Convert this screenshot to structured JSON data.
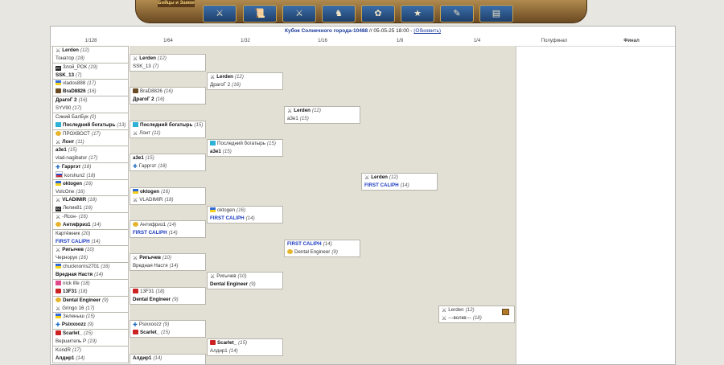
{
  "nav": {
    "logo_text": "Бойцы и Замки",
    "icons": [
      {
        "name": "battle-icon",
        "glyph": "⚔"
      },
      {
        "name": "scroll-icon",
        "glyph": "📜"
      },
      {
        "name": "swords-icon",
        "glyph": "⚔"
      },
      {
        "name": "knight-icon",
        "glyph": "♞"
      },
      {
        "name": "cake-icon",
        "glyph": "✿"
      },
      {
        "name": "stars-icon",
        "glyph": "★"
      },
      {
        "name": "book-icon",
        "glyph": "✎"
      },
      {
        "name": "chat-icon",
        "glyph": "▤"
      }
    ]
  },
  "header": {
    "title": "Кубок Солнечного города-10488",
    "sep": " // ",
    "date": "05-05-25 18:00",
    "sep2": " - ",
    "refresh": "(Обновить)"
  },
  "rounds": [
    "1/128",
    "1/64",
    "1/32",
    "1/16",
    "1/8",
    "1/4",
    "Полуфинал",
    "Финал"
  ],
  "r128": [
    [
      {
        "name": "Lerden",
        "score": "(12)",
        "icon": "swords",
        "win": true
      },
      {
        "name": "Тонатор",
        "score": "(18)"
      }
    ],
    [
      {
        "name": "Злой_РОК",
        "score": "(19)",
        "icon": "dc"
      },
      {
        "name": "SSK_13",
        "score": "(7)",
        "win": true
      }
    ],
    [
      {
        "name": "vlados888",
        "score": "(17)",
        "icon": "flag-ua"
      },
      {
        "name": "BraD8826",
        "score": "(16)",
        "icon": "crest",
        "win": true
      }
    ],
    [
      {
        "name": "ДрагоГ 2",
        "score": "(16)",
        "win": true
      },
      {
        "name": "SYV90",
        "score": "(17)"
      }
    ],
    [
      {
        "name": "Синий БалБук",
        "score": "(0)"
      },
      {
        "name": "Последний богатырь",
        "score": "(13)",
        "icon": "flag-kz",
        "win": true
      }
    ],
    [
      {
        "name": "ПРОХВОСТ",
        "score": "(17)",
        "icon": "coin"
      },
      {
        "name": "Лонт",
        "score": "(11)",
        "icon": "swords",
        "win": true
      }
    ],
    [
      {
        "name": "a3e1",
        "score": "(15)",
        "win": true
      },
      {
        "name": "vlad-nagibator",
        "score": "(17)"
      }
    ],
    [
      {
        "name": "Гарргэт",
        "score": "(18)",
        "icon": "cross",
        "win": true
      },
      {
        "name": "korshun2",
        "score": "(18)",
        "icon": "flag-ru"
      }
    ],
    [
      {
        "name": "oktogen",
        "score": "(16)",
        "icon": "flag-ua",
        "win": true
      },
      {
        "name": "VolcOne",
        "score": "(16)"
      }
    ],
    [
      {
        "name": "VLADIMIR",
        "score": "(18)",
        "icon": "swords",
        "win": true
      },
      {
        "name": "Лелик81",
        "score": "(16)",
        "icon": "dc"
      }
    ],
    [
      {
        "name": "-Ясон-",
        "score": "(16)",
        "icon": "swords"
      },
      {
        "name": "Антифриз1",
        "score": "(14)",
        "icon": "coin",
        "win": true
      }
    ],
    [
      {
        "name": "Картёжник",
        "score": "(20)"
      },
      {
        "name": "FIRST CALIPH",
        "score": "(14)",
        "blue": true
      }
    ],
    [
      {
        "name": "Ригычев",
        "score": "(10)",
        "icon": "swords",
        "win": true
      },
      {
        "name": "Чернорук",
        "score": "(16)"
      }
    ],
    [
      {
        "name": "chucknorris2701",
        "score": "(16)",
        "icon": "flag-ua"
      },
      {
        "name": "Вредная Настя",
        "score": "(14)",
        "win": true
      }
    ],
    [
      {
        "name": "nick life",
        "score": "(18)",
        "icon": "pinkx"
      },
      {
        "name": "13F31",
        "score": "(18)",
        "icon": "red",
        "win": true
      }
    ],
    [
      {
        "name": "Dental Engineer",
        "score": "(9)",
        "icon": "coin",
        "win": true
      },
      {
        "name": "Gringo 16",
        "score": "(17)",
        "icon": "swords"
      }
    ],
    [
      {
        "name": "Зеленыш",
        "score": "(15)",
        "icon": "flag-ua"
      },
      {
        "name": "Psixxoozz",
        "score": "(9)",
        "icon": "cross",
        "win": true
      }
    ],
    [
      {
        "name": "Scarlet_",
        "score": "(15)",
        "icon": "red",
        "win": true
      },
      {
        "name": "Вершитель Р",
        "score": "(19)"
      }
    ],
    [
      {
        "name": "KondR",
        "score": "(17)"
      },
      {
        "name": "Алдир1",
        "score": "(14)",
        "win": true
      }
    ]
  ],
  "r64": [
    [
      {
        "name": "Lerden",
        "score": "(12)",
        "icon": "swords",
        "win": true
      },
      {
        "name": "SSK_13",
        "score": "(7)"
      }
    ],
    [
      {
        "name": "BraD8826",
        "score": "(16)",
        "icon": "crest"
      },
      {
        "name": "ДрагоГ 2",
        "score": "(16)",
        "win": true
      }
    ],
    [
      {
        "name": "Последний богатырь",
        "score": "(15)",
        "icon": "flag-kz",
        "win": true
      },
      {
        "name": "Лонт",
        "score": "(11)",
        "icon": "swords"
      }
    ],
    [
      {
        "name": "a3e1",
        "score": "(15)",
        "win": true
      },
      {
        "name": "Гарргэт",
        "score": "(18)",
        "icon": "cross"
      }
    ],
    [
      {
        "name": "oktogen",
        "score": "(16)",
        "icon": "flag-ua",
        "win": true
      },
      {
        "name": "VLADIMIR",
        "score": "(18)",
        "icon": "swords"
      }
    ],
    [
      {
        "name": "Антифриз1",
        "score": "(14)",
        "icon": "coin"
      },
      {
        "name": "FIRST CALIPH",
        "score": "(14)",
        "blue": true
      }
    ],
    [
      {
        "name": "Ригычев",
        "score": "(10)",
        "icon": "swords",
        "win": true
      },
      {
        "name": "Вредная Настя",
        "score": "(14)"
      }
    ],
    [
      {
        "name": "13F31",
        "score": "(18)",
        "icon": "red"
      },
      {
        "name": "Dental Engineer",
        "score": "(9)",
        "win": true
      }
    ],
    [
      {
        "name": "Psixxoozz",
        "score": "(9)",
        "icon": "cross"
      },
      {
        "name": "Scarlet_",
        "score": "(15)",
        "icon": "red",
        "win": true
      }
    ],
    [
      {
        "name": "Алдир1",
        "score": "(14)",
        "win": true
      },
      {
        "name": "",
        "score": ""
      }
    ]
  ],
  "r32": [
    [
      {
        "name": "Lerden",
        "score": "(12)",
        "icon": "swords",
        "win": true
      },
      {
        "name": "ДрагоГ 2",
        "score": "(16)"
      }
    ],
    [
      {
        "name": "Последний богатырь",
        "score": "(15)",
        "icon": "flag-kz"
      },
      {
        "name": "a3e1",
        "score": "(15)",
        "win": true
      }
    ],
    [
      {
        "name": "oktogen",
        "score": "(16)",
        "icon": "flag-ua"
      },
      {
        "name": "FIRST CALIPH",
        "score": "(14)",
        "blue": true
      }
    ],
    [
      {
        "name": "Ригычев",
        "score": "(10)",
        "icon": "swords"
      },
      {
        "name": "Dental Engineer",
        "score": "(9)",
        "win": true
      }
    ],
    [
      {
        "name": "Scarlet_",
        "score": "(15)",
        "icon": "red",
        "win": true
      },
      {
        "name": "Алдир1",
        "score": "(14)"
      }
    ]
  ],
  "r16": [
    [
      {
        "name": "Lerden",
        "score": "(12)",
        "icon": "swords",
        "win": true
      },
      {
        "name": "a3e1",
        "score": "(15)"
      }
    ],
    [
      {
        "name": "FIRST CALIPH",
        "score": "(14)",
        "blue": true
      },
      {
        "name": "Dental Engineer",
        "score": "(9)",
        "icon": "coin"
      }
    ]
  ],
  "r8": [
    [
      {
        "name": "Lerden",
        "score": "(12)",
        "icon": "swords",
        "win": true
      },
      {
        "name": "FIRST CALIPH",
        "score": "(14)",
        "blue": true
      }
    ]
  ],
  "r4": [
    [
      {
        "name": "Lerden",
        "score": "(12)",
        "icon": "swords"
      },
      {
        "name": "---волкв---",
        "score": "(18)",
        "icon": "swords"
      }
    ]
  ]
}
